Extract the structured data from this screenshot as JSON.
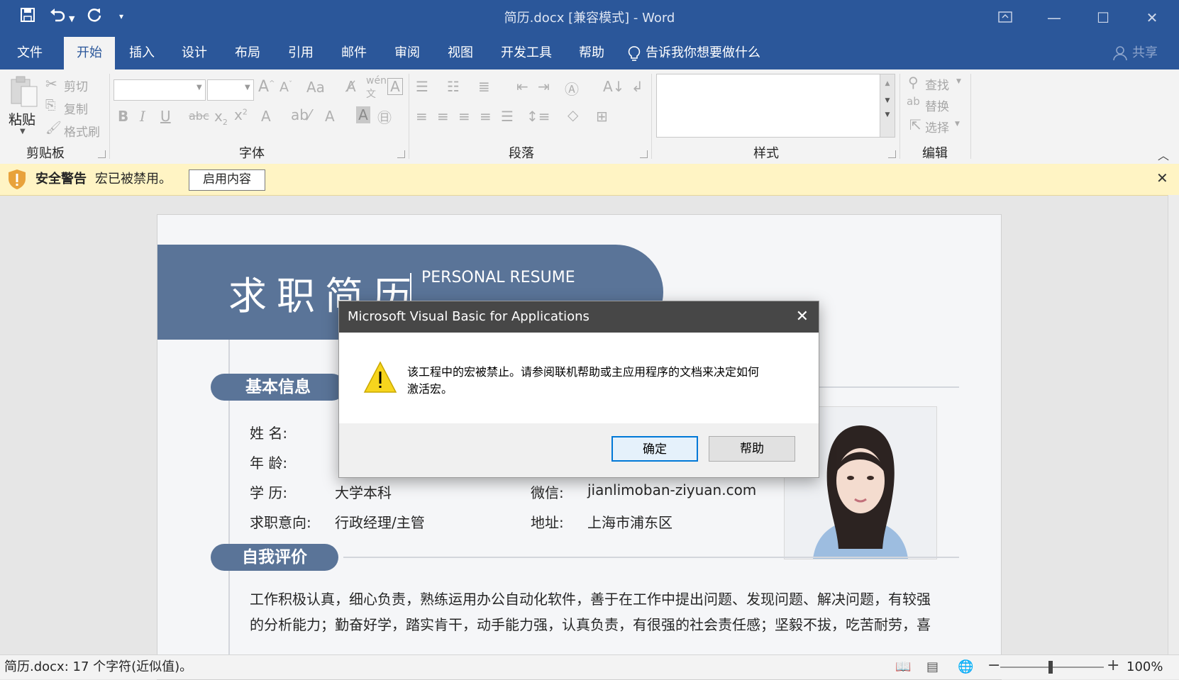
{
  "window": {
    "title": "简历.docx [兼容模式]  -  Word"
  },
  "qat": {
    "save_icon": "save-icon",
    "undo_icon": "undo-icon",
    "redo_icon": "redo-icon"
  },
  "tabs": [
    {
      "label": "文件"
    },
    {
      "label": "开始"
    },
    {
      "label": "插入"
    },
    {
      "label": "设计"
    },
    {
      "label": "布局"
    },
    {
      "label": "引用"
    },
    {
      "label": "邮件"
    },
    {
      "label": "审阅"
    },
    {
      "label": "视图"
    },
    {
      "label": "开发工具"
    },
    {
      "label": "帮助"
    }
  ],
  "tell_me": "告诉我你想要做什么",
  "share": "共享",
  "ribbon": {
    "paste": "粘贴",
    "cut": "剪切",
    "copy": "复制",
    "format_painter": "格式刷",
    "groups": {
      "clipboard": "剪贴板",
      "font": "字体",
      "paragraph": "段落",
      "styles": "样式",
      "editing": "编辑"
    },
    "find": "查找",
    "replace": "替换",
    "select": "选择"
  },
  "security_bar": {
    "title": "安全警告",
    "message": "宏已被禁用。",
    "button": "启用内容"
  },
  "document": {
    "header_title": "求职简历",
    "header_subtitle": "PERSONAL RESUME",
    "section_basic": "基本信息",
    "section_self": "自我评价",
    "fields": {
      "name_label": "姓      名:",
      "age_label": "年      龄:",
      "edu_label": "学      历:",
      "edu_value": "大学本科",
      "intent_label": "求职意向:",
      "intent_value": "行政经理/主管",
      "wechat_label": "微信:",
      "wechat_value": "jianlimoban-ziyuan.com",
      "addr_label": "地址:",
      "addr_value": "上海市浦东区"
    },
    "self_eval_line1": "工作积极认真，细心负责，熟练运用办公自动化软件，善于在工作中提出问题、发现问题、解决问题，有较强",
    "self_eval_line2": "的分析能力；勤奋好学，踏实肯干，动手能力强，认真负责，有很强的社会责任感；坚毅不拔，吃苦耐劳，喜"
  },
  "dialog": {
    "title": "Microsoft Visual Basic for Applications",
    "message_line1": "该工程中的宏被禁止。请参阅联机帮助或主应用程序的文档来决定如何",
    "message_line2": "激活宏。",
    "ok": "确定",
    "help": "帮助"
  },
  "statusbar": {
    "text": "简历.docx: 17 个字符(近似值)。",
    "zoom": "100%",
    "zoom_level": 1.0
  },
  "colors": {
    "title_blue": "#2b579a",
    "accent_steel": "#5a7498",
    "security_yellow": "#fff4c4",
    "dialog_title": "#474747"
  }
}
